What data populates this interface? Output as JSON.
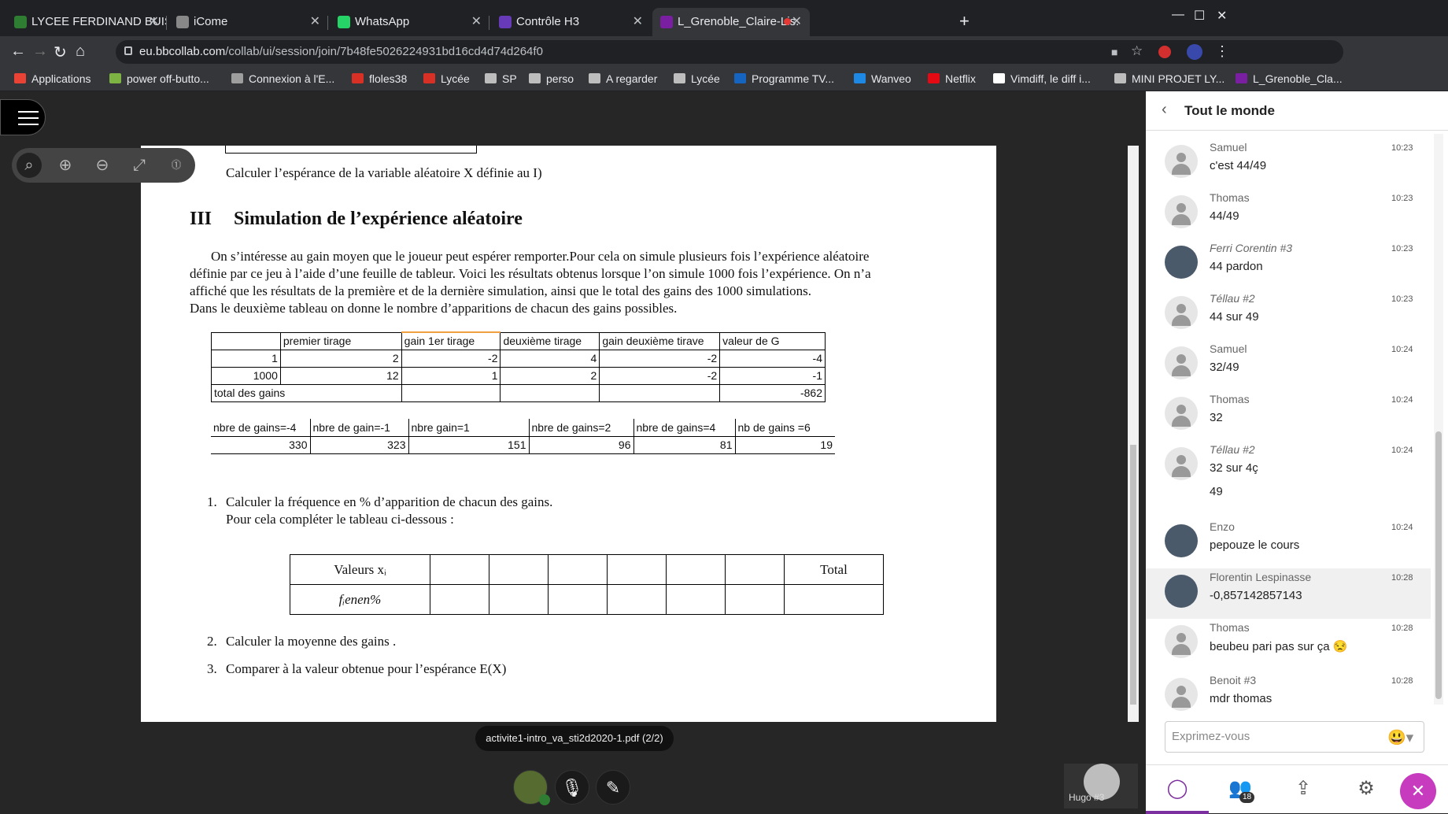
{
  "browser": {
    "tabs": [
      {
        "title": "LYCEE FERDINAND BUISSO",
        "color": "#2e7d32"
      },
      {
        "title": "iCome",
        "color": "#888888"
      },
      {
        "title": "WhatsApp",
        "color": "#25d366"
      },
      {
        "title": "Contrôle H3",
        "color": "#673ab7"
      },
      {
        "title": "L_Grenoble_Claire-Lis.",
        "color": "#7b1fa2"
      }
    ],
    "url_host": "eu.bbcollab.com",
    "url_path": "/collab/ui/session/join/7b48fe5026224931bd16cd4d74d264f0",
    "bookmarks": [
      {
        "label": "Applications",
        "color": "#ea4335"
      },
      {
        "label": "power off-butto...",
        "color": "#7cb342"
      },
      {
        "label": "Connexion à l'E...",
        "color": "#9e9e9e"
      },
      {
        "label": "floles38",
        "color": "#d93025"
      },
      {
        "label": "Lycée",
        "color": "#d93025"
      },
      {
        "label": "SP",
        "color": "#bdbdbd"
      },
      {
        "label": "perso",
        "color": "#bdbdbd"
      },
      {
        "label": "A regarder",
        "color": "#bdbdbd"
      },
      {
        "label": "Lycée",
        "color": "#bdbdbd"
      },
      {
        "label": "Programme TV...",
        "color": "#1565c0"
      },
      {
        "label": "Wanveo",
        "color": "#1e88e5"
      },
      {
        "label": "Netflix",
        "color": "#e50914"
      },
      {
        "label": "Vimdiff, le diff i...",
        "color": "#ffffff"
      },
      {
        "label": "MINI PROJET LY...",
        "color": "#bdbdbd"
      },
      {
        "label": "L_Grenoble_Cla...",
        "color": "#7b1fa2"
      }
    ]
  },
  "doc": {
    "top_text": "Calculer l’espérance de la variable aléatoire X définie au I)",
    "section_num": "III",
    "section_title": "Simulation de l’expérience aléatoire",
    "para1": "On s’intéresse au gain moyen que le joueur peut espérer remporter.Pour cela on simule plusieurs fois l’expérience aléatoire",
    "para2": "définie par ce jeu à l’aide d’une feuille de tableur. Voici les résultats obtenus lorsque l’on simule 1000 fois l’expérience. On n’a",
    "para3": "affiché que les résultats de la première et de la dernière simulation, ainsi que le total des gains des 1000 simulations.",
    "para4": "Dans le deuxième tableau on donne le nombre d’apparitions de chacun des gains possibles.",
    "sheet1": {
      "header": [
        "",
        "premier tirage",
        "gain 1er tirage",
        "deuxième tirage",
        "gain deuxième tirave",
        "valeur de G"
      ],
      "rows": [
        [
          "1",
          "2",
          "-2",
          "4",
          "-2",
          "-4"
        ],
        [
          "1000",
          "12",
          "1",
          "2",
          "-2",
          "-1"
        ],
        [
          "total des gains",
          "",
          "",
          "",
          "",
          "-862"
        ]
      ]
    },
    "sheet2": {
      "header": [
        "nbre de gains=-4",
        "nbre de gain=-1",
        "nbre gain=1",
        "nbre de gains=2",
        "nbre de gains=4",
        "nb de gains =6"
      ],
      "values": [
        "330",
        "323",
        "151",
        "96",
        "81",
        "19"
      ]
    },
    "q1_num": "1.",
    "q1_a": "Calculer la fréquence en % d’apparition de chacun des gains.",
    "q1_b": "Pour cela compléter le tableau ci-dessous :",
    "freq_row1": "Valeurs xᵢ",
    "freq_row2": "fᵢenen%",
    "freq_total": "Total",
    "q2_num": "2.",
    "q2": "Calculer la moyenne des gains .",
    "q3_num": "3.",
    "q3": "Comparer à la valeur obtenue pour l’espérance E(X)"
  },
  "page_label": "activite1-intro_va_sti2d2020-1.pdf   (2/2)",
  "self_name": "Hugo #3",
  "chat": {
    "title": "Tout le monde",
    "messages": [
      {
        "name": "Samuel",
        "text": "c'est 44/49",
        "time": "10:23",
        "italic": false,
        "photo": false
      },
      {
        "name": "Thomas",
        "text": "44/49",
        "time": "10:23",
        "italic": false,
        "photo": false
      },
      {
        "name": "Ferri Corentin #3",
        "text": "44 pardon",
        "time": "10:23",
        "italic": true,
        "photo": true
      },
      {
        "name": "Téllau #2",
        "text": "44 sur 49",
        "time": "10:23",
        "italic": true,
        "photo": false
      },
      {
        "name": "Samuel",
        "text": "32/49",
        "time": "10:24",
        "italic": false,
        "photo": false
      },
      {
        "name": "Thomas",
        "text": "32",
        "time": "10:24",
        "italic": false,
        "photo": false
      },
      {
        "name": "Téllau #2",
        "text": "32 sur 4ç",
        "time": "10:24",
        "italic": true,
        "photo": false
      },
      {
        "name": "Enzo",
        "text": "pepouze le cours",
        "time": "10:24",
        "italic": false,
        "photo": true
      },
      {
        "name": "Florentin Lespinasse",
        "text": "-0,857142857143",
        "time": "10:28",
        "italic": false,
        "photo": true
      },
      {
        "name": "Thomas",
        "text": "beubeu pari pas sur ça 😒",
        "time": "10:28",
        "italic": false,
        "photo": false
      },
      {
        "name": "Benoit #3",
        "text": "mdr thomas",
        "time": "10:28",
        "italic": false,
        "photo": false
      }
    ],
    "extra_line": "49",
    "input_placeholder": "Exprimez-vous",
    "participants_count": "18"
  }
}
